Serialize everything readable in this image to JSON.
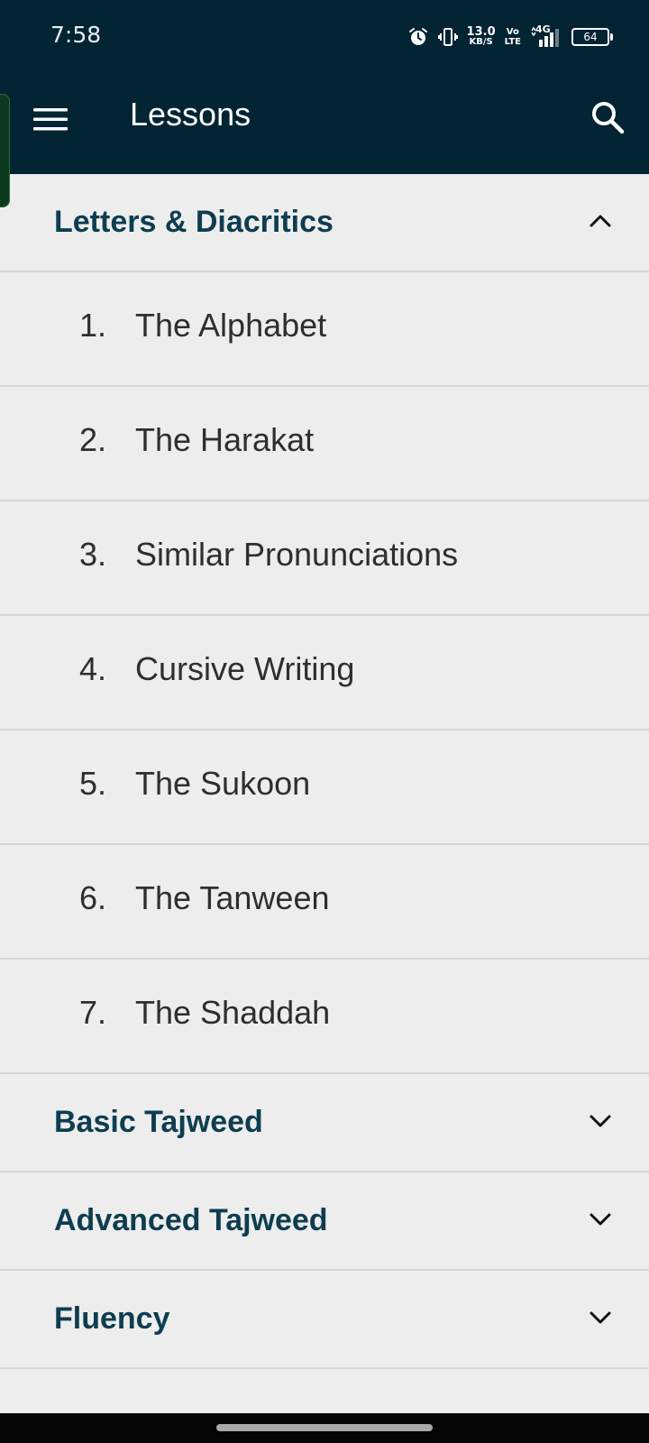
{
  "status_bar": {
    "time": "7:58",
    "net_speed_value": "13.0",
    "net_speed_unit": "KB/S",
    "volte_top": "Vo",
    "volte_bottom": "LTE",
    "network_type": "4G",
    "battery": "64"
  },
  "app_bar": {
    "title": "Lessons",
    "menu_icon": "hamburger-menu-icon",
    "search_icon": "search-icon"
  },
  "sections": [
    {
      "title": "Letters & Diacritics",
      "expanded": true,
      "lessons": [
        {
          "number": "1.",
          "title": "The Alphabet"
        },
        {
          "number": "2.",
          "title": "The Harakat"
        },
        {
          "number": "3.",
          "title": "Similar Pronunciations"
        },
        {
          "number": "4.",
          "title": "Cursive Writing"
        },
        {
          "number": "5.",
          "title": "The Sukoon"
        },
        {
          "number": "6.",
          "title": "The Tanween"
        },
        {
          "number": "7.",
          "title": "The Shaddah"
        }
      ]
    },
    {
      "title": "Basic Tajweed",
      "expanded": false
    },
    {
      "title": "Advanced Tajweed",
      "expanded": false
    },
    {
      "title": "Fluency",
      "expanded": false
    }
  ],
  "colors": {
    "app_bar": "#022433",
    "background": "#ededed",
    "section_title": "#0e3d50",
    "lesson_text": "#2e2e2e",
    "divider": "#d6d6d6"
  }
}
